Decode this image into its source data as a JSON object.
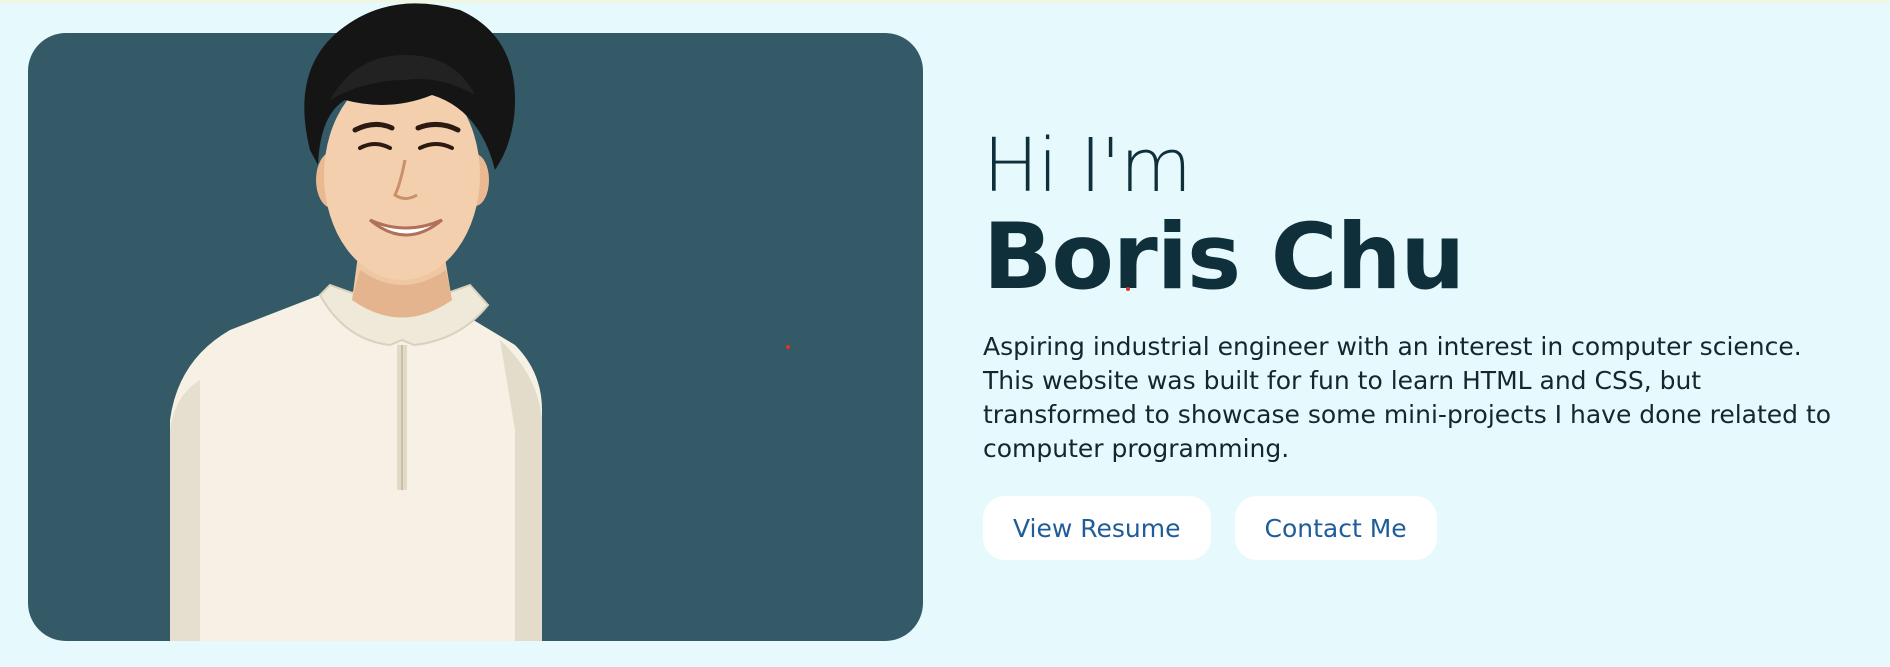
{
  "hero": {
    "greeting": "Hi I'm",
    "name": "Boris Chu",
    "bio": "Aspiring industrial engineer with an interest in computer science. This website was built for fun to learn HTML and CSS, but transformed to showcase some mini-projects I have done related to computer programming.",
    "buttons": {
      "resume": "View Resume",
      "contact": "Contact Me"
    }
  },
  "colors": {
    "page_background": "#e6f9fd",
    "photo_card": "#335a66",
    "heading_text": "#0f2f3a",
    "button_text": "#1f5d9a",
    "button_background": "#ffffff"
  }
}
